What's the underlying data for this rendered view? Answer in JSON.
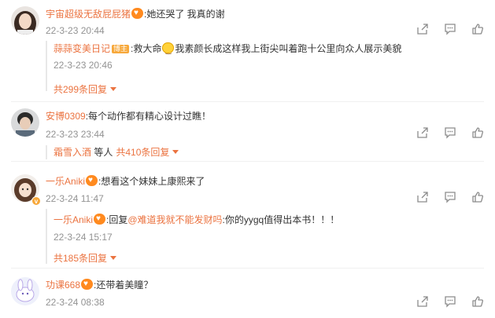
{
  "comments": [
    {
      "user": "宇宙超级无敌屁屁猪",
      "badge": "fan",
      "text": ":她还哭了 我真的谢",
      "time": "22-3-23 20:44",
      "reply": {
        "user": "蒜蒜变美日记",
        "tag": "博主",
        "text_before": ":救大命",
        "text_after": "我素颜长成这样我上街尖叫着跑十公里向众人展示美貌",
        "time": "22-3-23 20:46"
      },
      "more": "共299条回复"
    },
    {
      "user": "安博0309",
      "text": ":每个动作都有精心设计过瞧！",
      "time": "22-3-23 23:44",
      "extra": {
        "user": "霜雪入酒",
        "text": " 等人",
        "more": "共410条回复"
      }
    },
    {
      "user": "一乐Aniki",
      "badge": "fan",
      "text": ":想看这个妹妹上康熙来了",
      "time": "22-3-24 11:47",
      "reply": {
        "user": "一乐Aniki",
        "prefix": ":回复",
        "mention": "@难道我就不能发财吗",
        "text_after": ":你的yygq值得出本书！！！",
        "time": "22-3-24 15:17"
      },
      "more": "共185条回复"
    },
    {
      "user": "功课668",
      "badge": "fan",
      "text": ":还带着美瞳？",
      "time": "22-3-24 08:38"
    }
  ],
  "icons": {
    "share": "share-icon",
    "comment": "comment-icon",
    "like": "like-icon",
    "more_caret": "caret-down-icon"
  },
  "colors": {
    "username": "#eb7340",
    "time": "#939393",
    "text": "#333333",
    "icon": "#8c8c8c"
  }
}
